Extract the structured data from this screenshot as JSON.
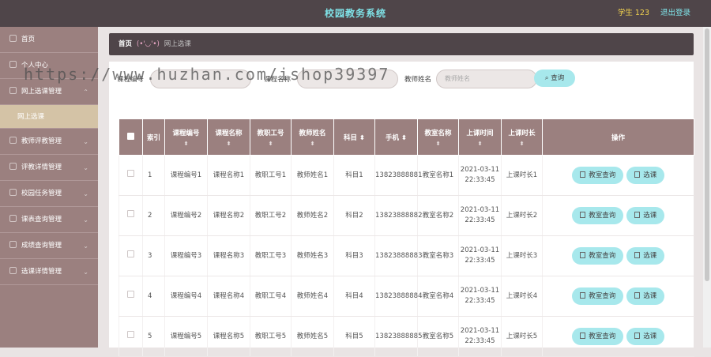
{
  "header": {
    "title": "校园教务系统",
    "user": "学生 123",
    "logout": "退出登录"
  },
  "sidebar": {
    "items": [
      {
        "label": "首页",
        "icon": "home-icon"
      },
      {
        "label": "个人中心",
        "icon": "person-icon"
      },
      {
        "label": "网上选课管理",
        "icon": "person-icon"
      },
      {
        "label": "网上选课",
        "sub": true
      },
      {
        "label": "教师评教管理",
        "icon": "person-icon"
      },
      {
        "label": "评教详情管理",
        "icon": "person-icon"
      },
      {
        "label": "校园任务管理",
        "icon": "person-icon"
      },
      {
        "label": "课表查询管理",
        "icon": "person-icon"
      },
      {
        "label": "成绩查询管理",
        "icon": "person-icon"
      },
      {
        "label": "选课详情管理",
        "icon": "person-icon"
      }
    ]
  },
  "breadcrumb": {
    "home": "首页",
    "emoticon": "(•'◡'•)",
    "current": "网上选课"
  },
  "search": {
    "label1": "课程编号",
    "label2": "课程名称",
    "label3": "教师姓名",
    "placeholder3": "教师姓名",
    "button": "查询"
  },
  "table": {
    "headers": [
      "索引",
      "课程编号",
      "课程名称",
      "教职工号",
      "教师姓名",
      "科目",
      "手机",
      "教室名称",
      "上课时间",
      "上课时长",
      "操作"
    ],
    "rows": [
      {
        "idx": "1",
        "code": "课程编号1",
        "name": "课程名称1",
        "staff": "教职工号1",
        "teacher": "教师姓名1",
        "subject": "科目1",
        "phone": "13823888881",
        "room": "教室名称1",
        "time": "2021-03-11 22:33:45",
        "duration": "上课时长1"
      },
      {
        "idx": "2",
        "code": "课程编号2",
        "name": "课程名称2",
        "staff": "教职工号2",
        "teacher": "教师姓名2",
        "subject": "科目2",
        "phone": "13823888882",
        "room": "教室名称2",
        "time": "2021-03-11 22:33:45",
        "duration": "上课时长2"
      },
      {
        "idx": "3",
        "code": "课程编号3",
        "name": "课程名称3",
        "staff": "教职工号3",
        "teacher": "教师姓名3",
        "subject": "科目3",
        "phone": "13823888883",
        "room": "教室名称3",
        "time": "2021-03-11 22:33:45",
        "duration": "上课时长3"
      },
      {
        "idx": "4",
        "code": "课程编号4",
        "name": "课程名称4",
        "staff": "教职工号4",
        "teacher": "教师姓名4",
        "subject": "科目4",
        "phone": "13823888884",
        "room": "教室名称4",
        "time": "2021-03-11 22:33:45",
        "duration": "上课时长4"
      },
      {
        "idx": "5",
        "code": "课程编号5",
        "name": "课程名称5",
        "staff": "教职工号5",
        "teacher": "教师姓名5",
        "subject": "科目5",
        "phone": "13823888885",
        "room": "教室名称5",
        "time": "2021-03-11 22:33:45",
        "duration": "上课时长5"
      }
    ],
    "op_query": "教室查询",
    "op_select": "选课"
  },
  "watermark": "https://www.huzhan.com/ishop39397",
  "colors": {
    "topbar": "#4f4549",
    "sidebar": "#9b807f",
    "accent": "#a7e8ec",
    "title": "#7fe3e8",
    "user": "#f2d34f"
  }
}
